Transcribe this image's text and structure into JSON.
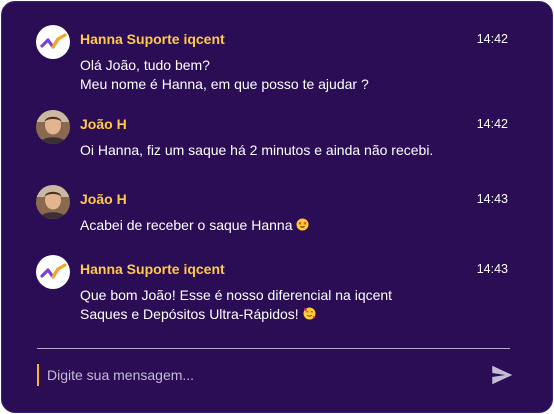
{
  "colors": {
    "panel_background": "#2a0d55",
    "sender_name": "#ffc94a",
    "message_text": "#ffffff",
    "input_cursor": "#f5b731"
  },
  "messages": [
    {
      "sender": "Hanna Suporte iqcent",
      "time": "14:42",
      "avatar_icon": "iqcent-logo-icon",
      "lines": [
        "Olá João, tudo bem?",
        "Meu nome é Hanna, em que posso te ajudar ?"
      ]
    },
    {
      "sender": "João H",
      "time": "14:42",
      "avatar_icon": "user-photo",
      "lines": [
        "Oi Hanna, fiz um saque há 2 minutos e ainda não recebi."
      ]
    },
    {
      "sender": "João H",
      "time": "14:43",
      "avatar_icon": "user-photo",
      "lines": [
        "Acabei de receber o saque Hanna"
      ],
      "emoji": "star-struck-emoji"
    },
    {
      "sender": "Hanna Suporte iqcent",
      "time": "14:43",
      "avatar_icon": "iqcent-logo-icon",
      "lines": [
        "Que bom João! Esse é nosso diferencial na iqcent",
        "Saques e Depósitos Ultra-Rápidos!"
      ],
      "emoji": "smiling-hearts-emoji"
    }
  ],
  "composer": {
    "placeholder": "Digite sua mensagem...",
    "value": "",
    "send_icon": "send-icon"
  }
}
